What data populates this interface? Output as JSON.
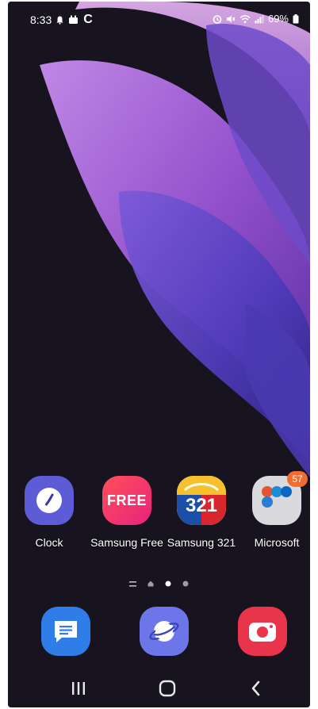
{
  "status_bar": {
    "time": "8:33",
    "carrier_glyph": "C",
    "battery": "69%",
    "icons": [
      "notification-bell-icon",
      "app-notification-icon",
      "alarm-icon",
      "mute-icon",
      "wifi-icon",
      "signal-icon",
      "battery-icon"
    ]
  },
  "apps": [
    {
      "label": "Clock",
      "icon": "clock-icon"
    },
    {
      "label": "Samsung Free",
      "icon": "samsung-free-icon",
      "icon_text": "FREE"
    },
    {
      "label": "Samsung 321",
      "icon": "samsung-321-icon",
      "icon_text": "321"
    },
    {
      "label": "Microsoft",
      "icon": "folder-icon",
      "badge": "57"
    }
  ],
  "page_indicator": {
    "pages": 3,
    "current": 2
  },
  "dock": [
    {
      "name": "messages",
      "icon": "messages-icon"
    },
    {
      "name": "internet",
      "icon": "internet-icon"
    },
    {
      "name": "camera",
      "icon": "camera-icon"
    }
  ],
  "navbar": {
    "buttons": [
      "recent-apps-icon",
      "home-icon",
      "back-icon"
    ]
  },
  "colors": {
    "background": "#17131f",
    "clock_icon": "#5e5bd6",
    "free_icon": "#f2356b",
    "badge": "#ef6c35",
    "messages_icon": "#2f7ee8",
    "internet_icon": "#6d76e8",
    "camera_icon": "#e8354b"
  }
}
